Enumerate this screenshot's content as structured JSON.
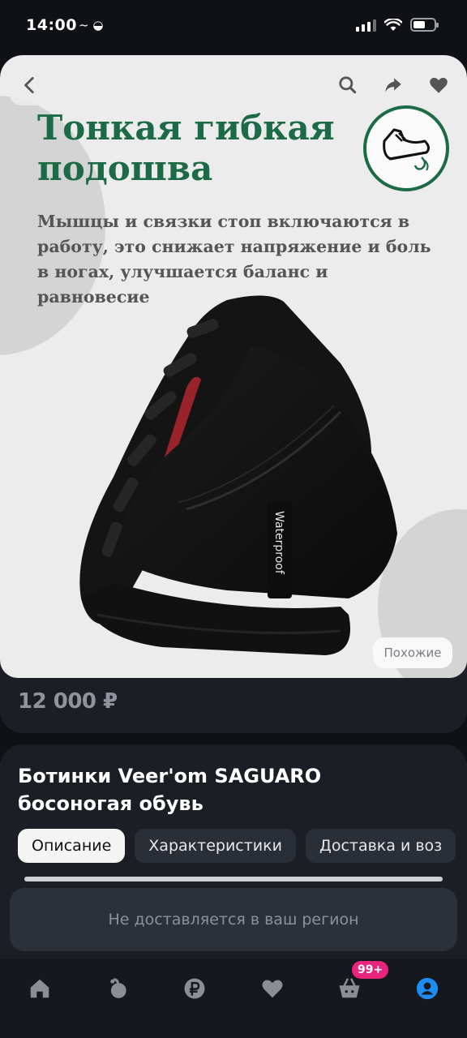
{
  "status_bar": {
    "time": "14:00",
    "extra": "~ ◒"
  },
  "product": {
    "promo": {
      "title": "Тонкая гибкая подошва",
      "text": "Мышцы и связки стоп включаются в работу, это снижает напряжение и боль в ногах, улучшается баланс и равновесие",
      "shoe_tag": "Waterproof"
    },
    "similar_label": "Похожие",
    "price": "12 000 ₽",
    "title": "Ботинки Veer'om SAGUARO босоногая обувь"
  },
  "tabs": [
    {
      "label": "Описание",
      "active": true
    },
    {
      "label": "Характеристики",
      "active": false
    },
    {
      "label": "Доставка и воз",
      "active": false
    }
  ],
  "delivery_notice": "Не доставляется в ваш регион",
  "nav": {
    "items": [
      "home-icon",
      "catalog-icon",
      "ruble-icon",
      "favorites-icon",
      "cart-icon",
      "profile-icon"
    ],
    "cart_badge": "99+",
    "active": "profile-icon"
  },
  "colors": {
    "accent_green": "#1d6b46",
    "badge_pink": "#e8247c",
    "profile_blue": "#1e8cf0"
  }
}
